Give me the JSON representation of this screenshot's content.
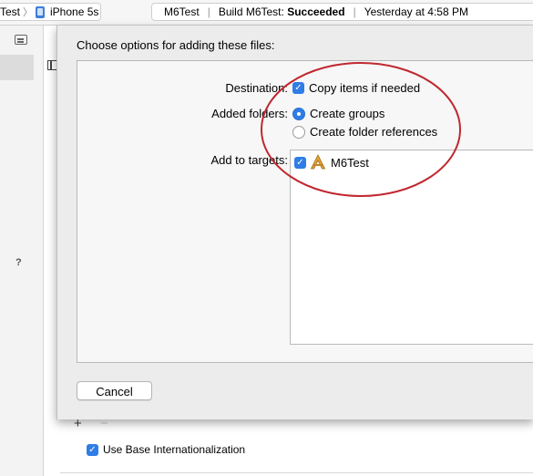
{
  "toolbar": {
    "scheme_name": "Test",
    "device_name": "iPhone 5s",
    "status_project": "M6Test",
    "status_build_prefix": "Build M6Test:",
    "status_build_result": "Succeeded",
    "status_time": "Yesterday at 4:58 PM"
  },
  "navigator": {
    "help_mark": "?"
  },
  "sheet": {
    "title": "Choose options for adding these files:",
    "destination_label": "Destination:",
    "copy_items_label": "Copy items if needed",
    "copy_items_checked": true,
    "added_folders_label": "Added folders:",
    "create_groups_label": "Create groups",
    "create_folder_refs_label": "Create folder references",
    "selected_folder_option": "Create groups",
    "add_to_targets_label": "Add to targets:",
    "targets": [
      {
        "name": "M6Test",
        "checked": true,
        "icon": "app-target-icon"
      }
    ],
    "cancel_label": "Cancel"
  },
  "below": {
    "plus_symbol": "+",
    "minus_symbol": "−",
    "base_intl_label": "Use Base Internationalization",
    "base_intl_checked": true
  },
  "colors": {
    "accent": "#2f7de6",
    "annotation_circle": "#c0282f"
  }
}
